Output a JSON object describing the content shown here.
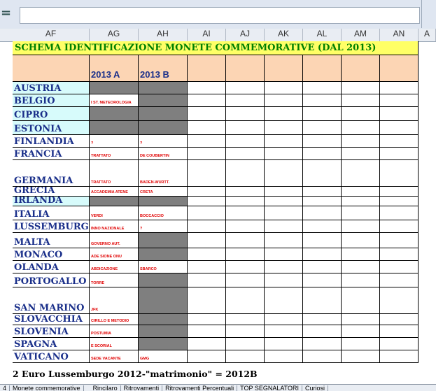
{
  "formula_bar": {
    "symbol": "=",
    "value": ""
  },
  "columns": [
    "AF",
    "AG",
    "AH",
    "AI",
    "AJ",
    "AK",
    "AL",
    "AM",
    "AN",
    "A"
  ],
  "sheet": {
    "title": "SCHEMA IDENTIFICAZIONE MONETE COMMEMORATIVE (DAL 2013)",
    "year_a": "2013 A",
    "year_b": "2013 B",
    "rows": [
      {
        "country": "AUSTRIA",
        "a": "",
        "b": ""
      },
      {
        "country": "BELGIO",
        "a": "I ST. METEOROLOGIA",
        "b": ""
      },
      {
        "country": "CIPRO",
        "a": "",
        "b": ""
      },
      {
        "country": "ESTONIA",
        "a": "",
        "b": ""
      },
      {
        "country": "FINLANDIA",
        "a": "?",
        "b": "?"
      },
      {
        "country": "FRANCIA",
        "a": "TRATTATO",
        "b": "DE COUBERTIN"
      },
      {
        "country": "GERMANIA",
        "a": "TRATTATO",
        "b": "BADEN-WURTT."
      },
      {
        "country": "GRECIA",
        "a": "ACCADEMIA ATENE",
        "b": "CRETA"
      },
      {
        "country": "IRLANDA",
        "a": "",
        "b": ""
      },
      {
        "country": "ITALIA",
        "a": "VERDI",
        "b": "BOCCACCIO"
      },
      {
        "country": "LUSSEMBURGO",
        "a": "INNO NAZIONALE",
        "b": "?"
      },
      {
        "country": "MALTA",
        "a": "GOVERNO AUT.",
        "b": ""
      },
      {
        "country": "MONACO",
        "a": "ADE SIONE ONU",
        "b": ""
      },
      {
        "country": "OLANDA",
        "a": "ABDICAZIONE",
        "b": "SBARCO"
      },
      {
        "country": "PORTOGALLO",
        "a": "TORRE",
        "b": ""
      },
      {
        "country": "SAN MARINO",
        "a": "JFK",
        "b": ""
      },
      {
        "country": "SLOVACCHIA",
        "a": "CIRILLO E METODIO",
        "b": ""
      },
      {
        "country": "SLOVENIA",
        "a": "POSTUMIA",
        "b": ""
      },
      {
        "country": "SPAGNA",
        "a": "E SCORIAL",
        "b": ""
      },
      {
        "country": "VATICANO",
        "a": "SEDE VACANTE",
        "b": "GMG"
      }
    ],
    "footer": "2 Euro Lussemburgo 2012-\"matrimonio\" = 2012B"
  },
  "tabs": [
    "4",
    "Monete commemorative",
    "",
    "Rincilaro",
    "Ritrovamenti",
    "Ritrovamenti Percentuali",
    "TOP SEGNALATORI",
    "Curiosi"
  ],
  "colors": {
    "title_bg": "#ffff66",
    "header_bg": "#fcd5b4",
    "country_bg": "#d7fbfb",
    "empty_bg": "#7f7f7f",
    "red_text": "#e00000",
    "blue_text": "#1a2f8a",
    "green_text": "#008000"
  }
}
